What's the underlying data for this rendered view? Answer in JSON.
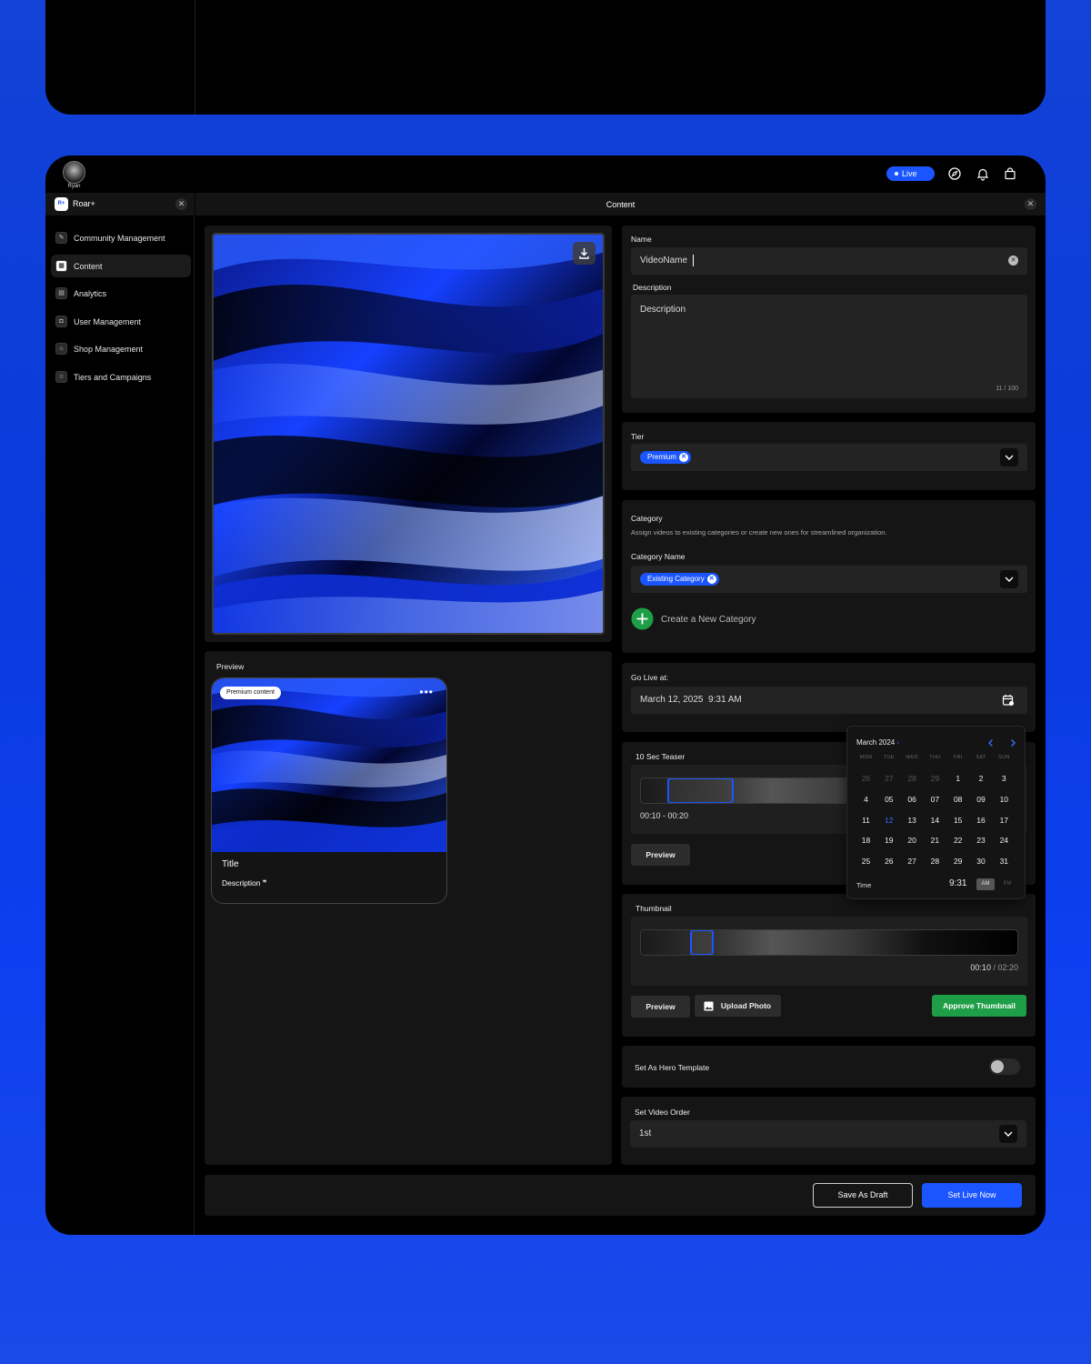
{
  "user": {
    "name": "Ryan"
  },
  "header": {
    "live_label": "Live"
  },
  "brand": {
    "name": "Roar+",
    "logo_text": "R+"
  },
  "sidebar": {
    "items": [
      {
        "label": "Community Management",
        "icon": "community-icon"
      },
      {
        "label": "Content",
        "icon": "content-icon",
        "active": true
      },
      {
        "label": "Analytics",
        "icon": "analytics-icon"
      },
      {
        "label": "User Management",
        "icon": "user-management-icon"
      },
      {
        "label": "Shop Management",
        "icon": "shop-icon"
      },
      {
        "label": "Tiers and Campaigns",
        "icon": "star-icon"
      }
    ]
  },
  "content": {
    "title": "Content"
  },
  "preview": {
    "label": "Preview",
    "badge": "Premium content",
    "card_title": "Title",
    "card_description": "Description",
    "quote_glyph": "❞"
  },
  "form": {
    "name_label": "Name",
    "name_value": "VideoName",
    "description_label": "Description",
    "description_value": "Description",
    "char_count": "11 / 100",
    "tier_label": "Tier",
    "tier_chip": "Premium",
    "category_label": "Category",
    "category_help": "Assign videos to existing categories or create new ones for streamlined organization.",
    "category_name_label": "Category Name",
    "category_chip": "Existing Category",
    "create_category": "Create a New Category",
    "go_live_label": "Go Live at:",
    "go_live_value": "March 12, 2025  9:31 AM",
    "teaser_label": "10 Sec Teaser",
    "teaser_range": "00:10 - 00:20",
    "preview_btn": "Preview",
    "thumbnail_label": "Thumbnail",
    "thumbnail_time": "00:10",
    "thumbnail_total": "/ 02:20",
    "upload_photo": "Upload Photo",
    "approve_thumbnail": "Approve Thumbnail",
    "hero_label": "Set As Hero Template",
    "hero_enabled": false,
    "order_label": "Set Video Order",
    "order_value": "1st"
  },
  "calendar": {
    "month": "March 2024",
    "weekdays": [
      "MON",
      "TUE",
      "WED",
      "THU",
      "FRI",
      "SAT",
      "SUN"
    ],
    "weeks": [
      [
        "26",
        "27",
        "28",
        "29",
        "1",
        "2",
        "3"
      ],
      [
        "4",
        "05",
        "06",
        "07",
        "08",
        "09",
        "10"
      ],
      [
        "11",
        "12",
        "13",
        "14",
        "15",
        "16",
        "17"
      ],
      [
        "18",
        "19",
        "20",
        "21",
        "22",
        "23",
        "24"
      ],
      [
        "25",
        "26",
        "27",
        "28",
        "29",
        "30",
        "31"
      ]
    ],
    "dim_cells": [
      "0-0",
      "0-1",
      "0-2",
      "0-3"
    ],
    "selected_cell": "2-1",
    "time_label": "Time",
    "time_value": "9:31",
    "am": "AM",
    "pm": "PM",
    "accent_color": "#3a6bff"
  },
  "footer": {
    "save_draft": "Save As Draft",
    "set_live": "Set Live Now"
  },
  "colors": {
    "accent": "#1a55ff",
    "approve": "#1e9e47",
    "create_icon": "#1e9e47"
  }
}
